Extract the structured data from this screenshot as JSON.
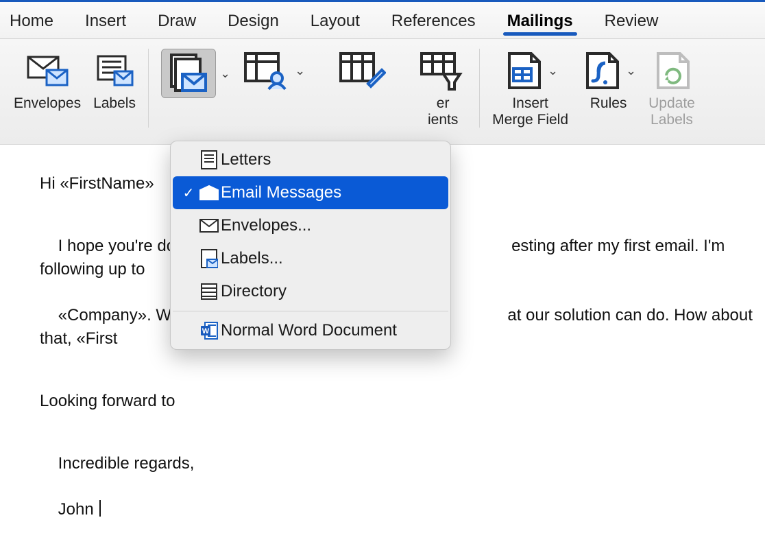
{
  "tabs": {
    "items": [
      {
        "label": "Home"
      },
      {
        "label": "Insert"
      },
      {
        "label": "Draw"
      },
      {
        "label": "Design"
      },
      {
        "label": "Layout"
      },
      {
        "label": "References"
      },
      {
        "label": "Mailings"
      },
      {
        "label": "Review"
      }
    ],
    "active_index": 6
  },
  "ribbon": {
    "envelopes": {
      "label": "Envelopes"
    },
    "labels": {
      "label": "Labels"
    },
    "start": {
      "label": ""
    },
    "recipients": {
      "label": ""
    },
    "filter_right": {
      "line1": "er",
      "line2": "ients"
    },
    "insert_merge_field": {
      "label": "Insert\nMerge Field"
    },
    "rules": {
      "label": "Rules"
    },
    "update_labels": {
      "label": "Update\nLabels"
    }
  },
  "menu": {
    "items": [
      {
        "label": "Letters"
      },
      {
        "label": "Email Messages"
      },
      {
        "label": "Envelopes..."
      },
      {
        "label": "Labels..."
      },
      {
        "label": "Directory"
      },
      {
        "label": "Normal Word Document"
      }
    ],
    "selected_index": 1
  },
  "document": {
    "line0": "Hi «FirstName»",
    "line1": "I hope you're doing",
    "line1b": "esting after my first email. I'm following up to",
    "line2": "«Company». We can",
    "line2b": "at our solution can do. How about that, «First",
    "line3": "Looking forward to ",
    "line4": "Incredible regards,",
    "line5": "John "
  }
}
